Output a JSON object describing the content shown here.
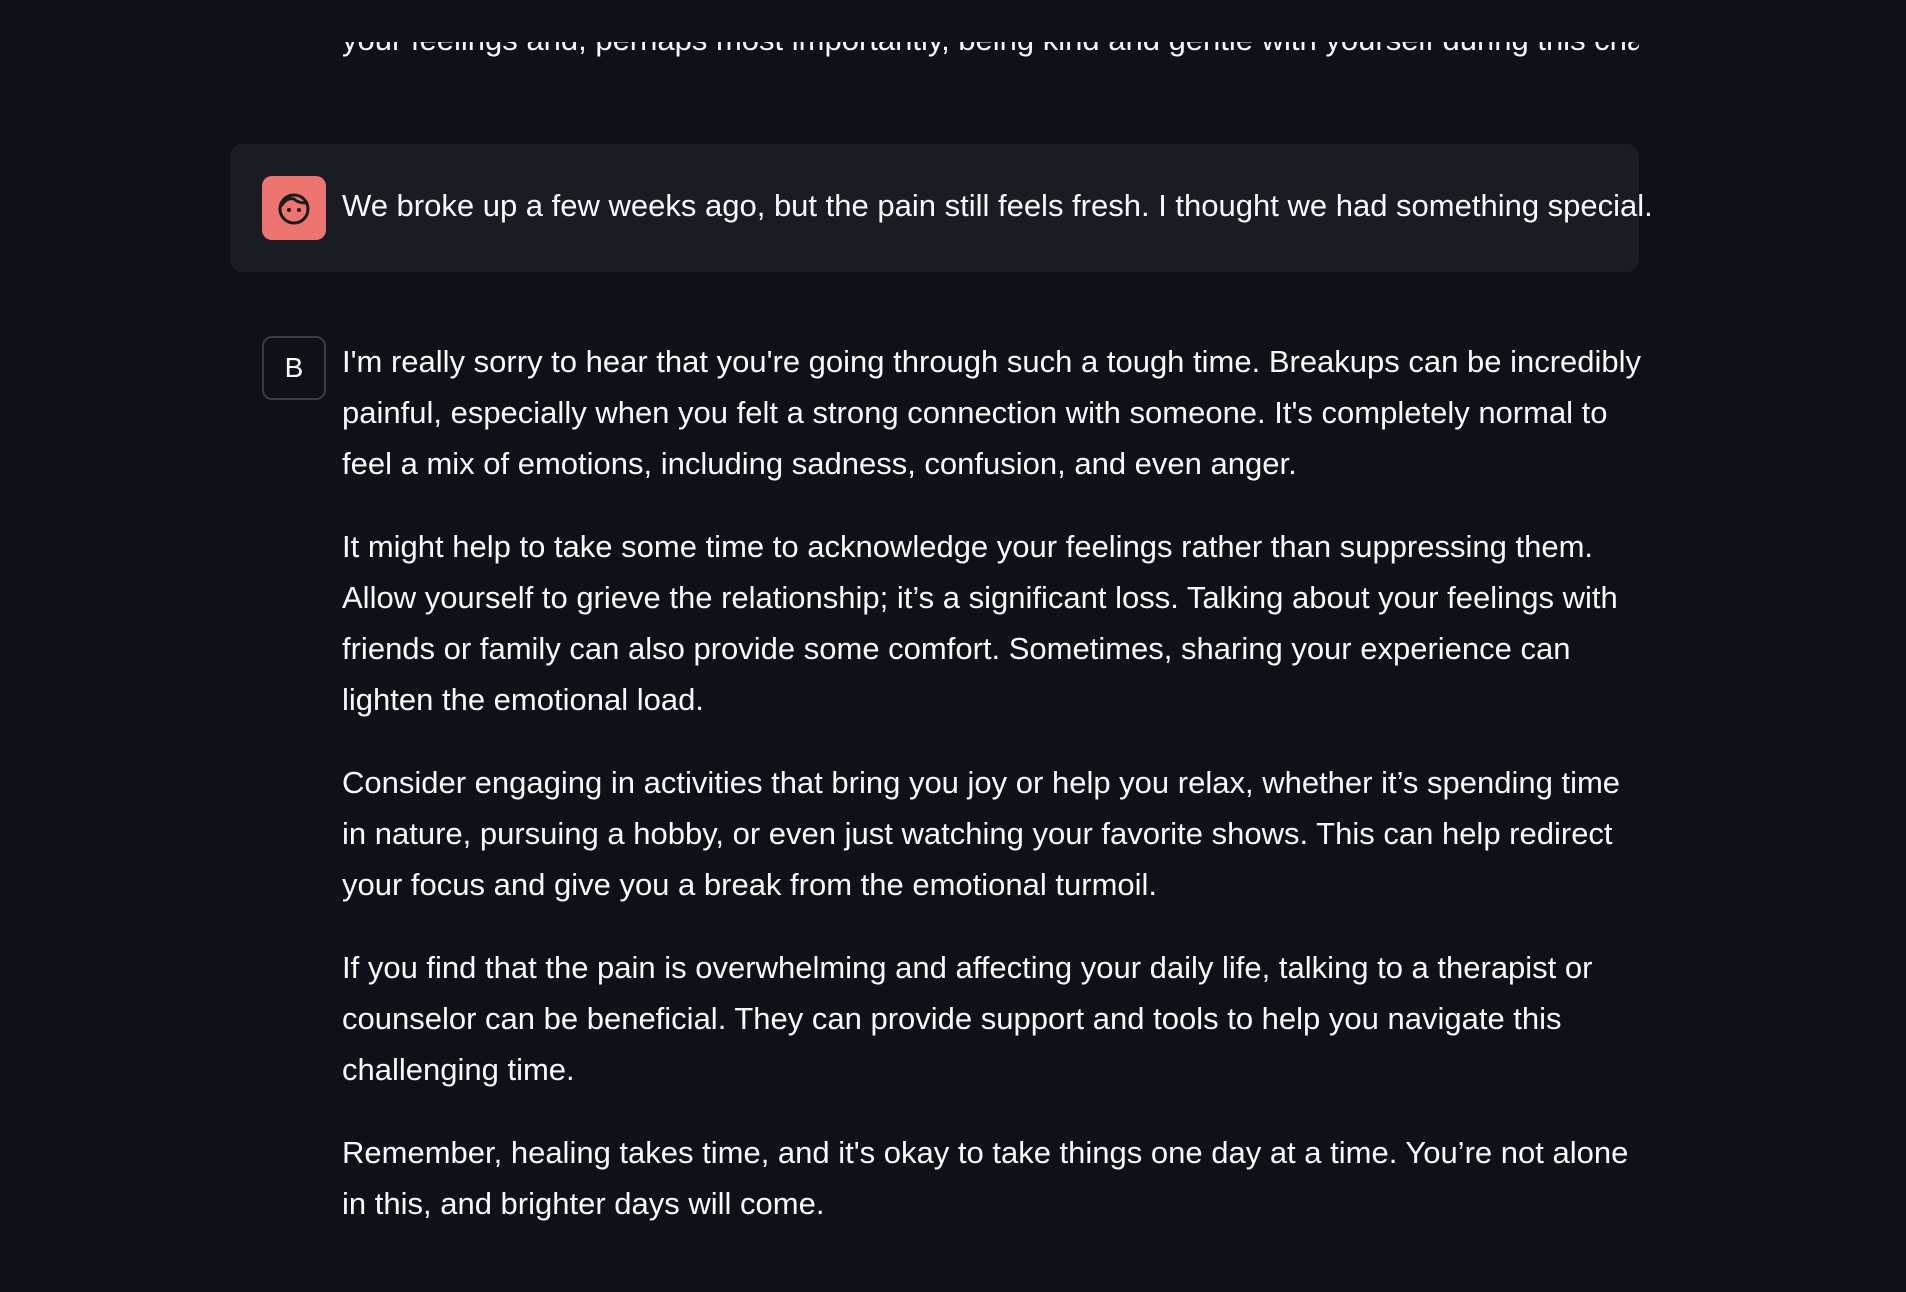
{
  "previous_message_fragment": "your feelings and, perhaps most importantly, being kind and gentle with yourself during this challenging time right now.",
  "user_message": {
    "avatar_icon": "face-icon",
    "avatar_color": "#ee7470",
    "text": "We broke up a few weeks ago, but the pain still feels fresh. I thought we had something special."
  },
  "assistant_message": {
    "avatar_letter": "B",
    "paragraphs": [
      "I'm really sorry to hear that you're going through such a tough time. Breakups can be incredibly painful, especially when you felt a strong connection with someone. It's completely normal to feel a mix of emotions, including sadness, confusion, and even anger.",
      "It might help to take some time to acknowledge your feelings rather than suppressing them. Allow yourself to grieve the relationship; it’s a significant loss. Talking about your feelings with friends or family can also provide some comfort. Sometimes, sharing your experience can lighten the emotional load.",
      "Consider engaging in activities that bring you joy or help you relax, whether it’s spending time in nature, pursuing a hobby, or even just watching your favorite shows. This can help redirect your focus and give you a break from the emotional turmoil.",
      "If you find that the pain is overwhelming and affecting your daily life, talking to a therapist or counselor can be beneficial. They can provide support and tools to help you navigate this challenging time.",
      "Remember, healing takes time, and it's okay to take things one day at a time. You’re not alone in this, and brighter days will come."
    ]
  },
  "colors": {
    "background": "#0e1117",
    "user_bubble": "#1a1c24",
    "text": "#fafafa"
  }
}
